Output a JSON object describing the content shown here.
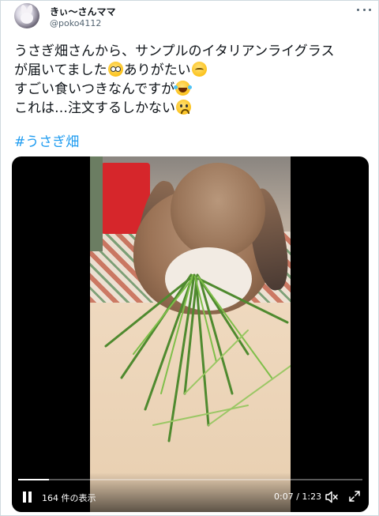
{
  "author": {
    "display_name": "きぃ〜さんママ",
    "handle": "@poko4112",
    "avatar_icon": "bunny-avatar-icon"
  },
  "menu_icon": "more-horizontal-icon",
  "tweet": {
    "line1": "うさぎ畑さんから、サンプルのイタリアンライグラス",
    "line2_a": "が届いてました",
    "line2_b": "ありがたい",
    "line3": "すごい食いつきなんですが",
    "line4": "これは…注文するしかない",
    "emojis": [
      "flushed-face",
      "relieved-face",
      "face-with-tears-of-joy",
      "anxious-face"
    ],
    "hashtag": "#うさぎ畑"
  },
  "video": {
    "views": "164 件の表示",
    "time": "0:07 / 1:23",
    "progress": 0.09,
    "pause_icon": "pause-icon",
    "mute_icon": "mute-icon",
    "fullscreen_icon": "fullscreen-icon"
  },
  "colors": {
    "accent": "#1d9bf0",
    "text": "#0f1419",
    "muted": "#536471"
  }
}
